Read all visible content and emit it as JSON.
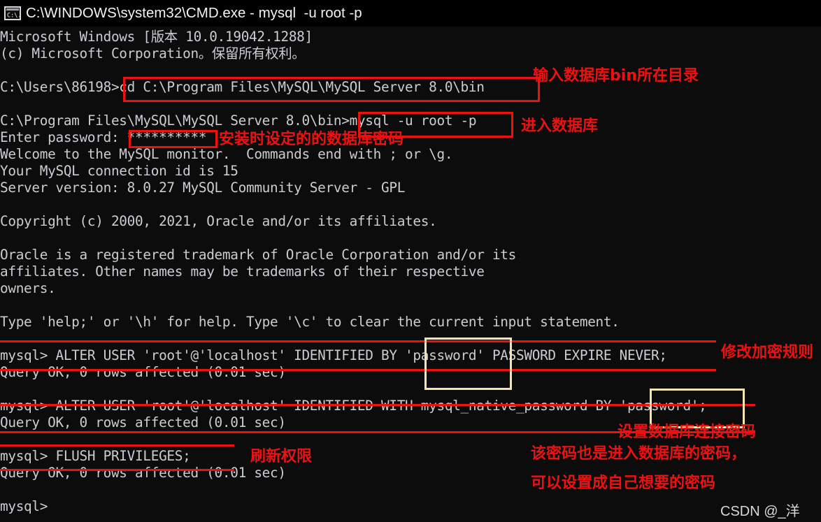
{
  "window": {
    "icon": "cmd-console-icon",
    "title": "C:\\WINDOWS\\system32\\CMD.exe - mysql  -u root -p"
  },
  "terminal": {
    "background_color": "#0c0c0c",
    "text_color": "#ccccd3",
    "lines": [
      "Microsoft Windows [版本 10.0.19042.1288]",
      "(c) Microsoft Corporation。保留所有权利。",
      "",
      "C:\\Users\\86198>cd C:\\Program Files\\MySQL\\MySQL Server 8.0\\bin",
      "",
      "C:\\Program Files\\MySQL\\MySQL Server 8.0\\bin>mysql -u root -p",
      "Enter password: **********",
      "Welcome to the MySQL monitor.  Commands end with ; or \\g.",
      "Your MySQL connection id is 15",
      "Server version: 8.0.27 MySQL Community Server - GPL",
      "",
      "Copyright (c) 2000, 2021, Oracle and/or its affiliates.",
      "",
      "Oracle is a registered trademark of Oracle Corporation and/or its",
      "affiliates. Other names may be trademarks of their respective",
      "owners.",
      "",
      "Type 'help;' or '\\h' for help. Type '\\c' to clear the current input statement.",
      "",
      "mysql> ALTER USER 'root'@'localhost' IDENTIFIED BY 'password' PASSWORD EXPIRE NEVER;",
      "Query OK, 0 rows affected (0.01 sec)",
      "",
      "mysql> ALTER USER 'root'@'localhost' IDENTIFIED WITH mysql_native_password BY 'password';",
      "Query OK, 0 rows affected (0.01 sec)",
      "",
      "mysql> FLUSH PRIVILEGES;",
      "Query OK, 0 rows affected (0.01 sec)",
      "",
      "mysql>"
    ]
  },
  "annotations": {
    "color_red": "#ee1111",
    "color_yellow": "#f5e3b0",
    "notes": [
      {
        "text": "输入数据库bin所在目录"
      },
      {
        "text": "进入数据库"
      },
      {
        "text": "安装时设定的的数据库密码"
      },
      {
        "text": "修改加密规则"
      },
      {
        "text": "设置数据库连接密码"
      },
      {
        "text": "刷新权限"
      },
      {
        "text": "该密码也是进入数据库的密码，"
      },
      {
        "text": "可以设置成自己想要的密码"
      }
    ]
  },
  "watermark": {
    "text": "CSDN @_洋"
  }
}
